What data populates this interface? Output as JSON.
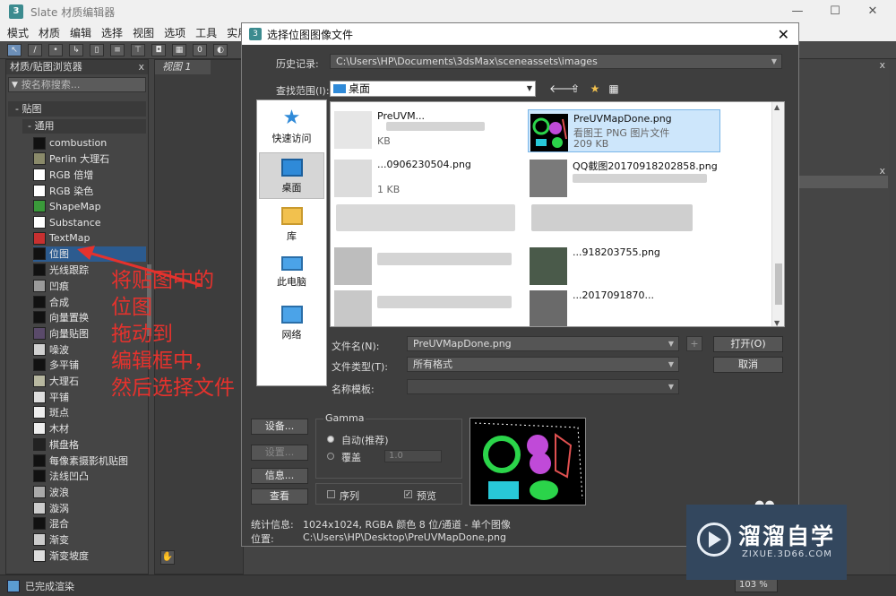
{
  "window": {
    "app_icon": "3",
    "title": "Slate 材质编辑器",
    "minimize": "—",
    "maximize": "☐",
    "close": "✕"
  },
  "menu": [
    "模式",
    "材质",
    "编辑",
    "选择",
    "视图",
    "选项",
    "工具",
    "实用"
  ],
  "browser": {
    "title": "材质/贴图浏览器",
    "close": "x",
    "search_placeholder": "按名称搜索...",
    "rollout": "- 贴图",
    "subrollout": "- 通用",
    "items": [
      {
        "label": "combustion",
        "swatch": "#111111"
      },
      {
        "label": "Perlin 大理石",
        "swatch": "#8a8a6a"
      },
      {
        "label": "RGB 倍增",
        "swatch": "#ffffff"
      },
      {
        "label": "RGB 染色",
        "swatch": "#ffffff"
      },
      {
        "label": "ShapeMap",
        "swatch": "#3a9a3a"
      },
      {
        "label": "Substance",
        "swatch": "#ffffff"
      },
      {
        "label": "TextMap",
        "swatch": "#c83030"
      },
      {
        "label": "位图",
        "swatch": "#111111"
      },
      {
        "label": "光线跟踪",
        "swatch": "#111111"
      },
      {
        "label": "凹痕",
        "swatch": "#9a9a9a"
      },
      {
        "label": "合成",
        "swatch": "#111111"
      },
      {
        "label": "向量置换",
        "swatch": "#111111"
      },
      {
        "label": "向量贴图",
        "swatch": "#5a4a6a"
      },
      {
        "label": "噪波",
        "swatch": "#d0d0d0"
      },
      {
        "label": "多平铺",
        "swatch": "#111111"
      },
      {
        "label": "大理石",
        "swatch": "#b8b8a0"
      },
      {
        "label": "平铺",
        "swatch": "#dddddd"
      },
      {
        "label": "斑点",
        "swatch": "#eeeeee"
      },
      {
        "label": "木材",
        "swatch": "#eeeeee"
      },
      {
        "label": "棋盘格",
        "swatch": "#222222"
      },
      {
        "label": "每像素摄影机贴图",
        "swatch": "#111111"
      },
      {
        "label": "法线凹凸",
        "swatch": "#111111"
      },
      {
        "label": "波浪",
        "swatch": "#aaaaaa"
      },
      {
        "label": "漩涡",
        "swatch": "#cccccc"
      },
      {
        "label": "混合",
        "swatch": "#111111"
      },
      {
        "label": "渐变",
        "swatch": "#cccccc"
      },
      {
        "label": "渐变坡度",
        "swatch": "#dddddd"
      }
    ],
    "selected_index": 7
  },
  "nodeview": {
    "tab": "视图 1"
  },
  "annotation": {
    "lines": [
      "将贴图中的",
      "位图",
      "拖动到",
      "编辑框中，",
      "然后选择文件"
    ],
    "color": "#e5322d"
  },
  "dialog": {
    "title": "选择位图图像文件",
    "history_label": "历史记录:",
    "history_value": "C:\\Users\\HP\\Documents\\3dsMax\\sceneassets\\images",
    "lookin_label": "查找范围(I):",
    "lookin_value": "桌面",
    "places": [
      "快速访问",
      "桌面",
      "库",
      "此电脑",
      "网络"
    ],
    "files": [
      {
        "name": "PreUVM...",
        "type": "",
        "size": "KB"
      },
      {
        "name": "PreUVMapDone.png",
        "type": "看图王 PNG 图片文件",
        "size": "209 KB"
      },
      {
        "name": "...0906230504.png",
        "type": "",
        "size": "1 KB"
      },
      {
        "name": "QQ截图20170918202858.png",
        "type": "",
        "size": ""
      },
      {
        "name": "...918203755.png",
        "type": "",
        "size": ""
      },
      {
        "name": "...2017091870...",
        "type": "",
        "size": ""
      }
    ],
    "filename_label": "文件名(N):",
    "filename_value": "PreUVMapDone.png",
    "filetype_label": "文件类型(T):",
    "filetype_value": "所有格式",
    "template_label": "名称模板:",
    "open_button": "打开(O)",
    "cancel_button": "取消",
    "plus_button": "+",
    "setup_button": "设备...",
    "settings_button": "设置...",
    "info_button": "信息...",
    "view_button": "查看",
    "gamma_title": "Gamma",
    "gamma_auto": "自动(推荐)",
    "gamma_override": "覆盖",
    "gamma_override_value": "1.0",
    "sequence_label": "序列",
    "preview_label": "预览",
    "stats_label": "统计信息:",
    "stats_value": "1024x1024, RGBA 颜色 8 位/通道 - 单个图像",
    "location_label": "位置:",
    "location_value": "C:\\Users\\HP\\Desktop\\PreUVMapDone.png"
  },
  "status": {
    "text": "已完成渲染",
    "zoom": "103 %"
  },
  "logo": {
    "text": "溜溜自学",
    "url_text": "ZIXUE.3D66.COM"
  }
}
